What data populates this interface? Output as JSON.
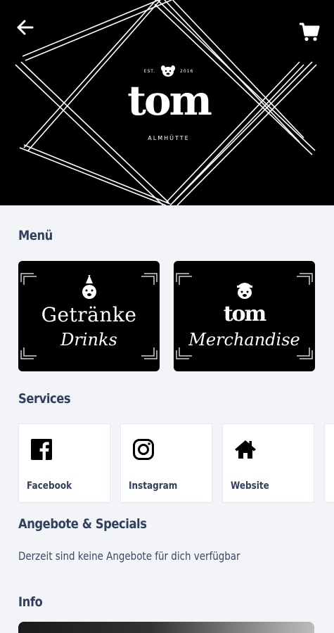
{
  "header": {
    "back_icon": "arrow-left-icon",
    "cart_icon": "cart-icon",
    "logo": {
      "est_left": "EST.",
      "est_right": "2016",
      "wordmark": "tom",
      "subtitle": "ALMHÜTTE"
    }
  },
  "menu": {
    "title": "Menü",
    "cards": [
      {
        "title": "Getränke",
        "subtitle": "Drinks",
        "icon": "dog-party-hat-icon"
      },
      {
        "title": "tom",
        "subtitle": "Merchandise",
        "icon": "dog-cap-icon"
      }
    ]
  },
  "services": {
    "title": "Services",
    "items": [
      {
        "label": "Facebook",
        "icon": "facebook-icon"
      },
      {
        "label": "Instagram",
        "icon": "instagram-icon"
      },
      {
        "label": "Website",
        "icon": "home-icon"
      }
    ]
  },
  "offers": {
    "title": "Angebote & Specials",
    "empty_message": "Derzeit sind keine Angebote für dich verfügbar"
  },
  "info": {
    "title": "Info"
  },
  "colors": {
    "background": "#f2f4f8",
    "heading": "#2f3f5d",
    "hero": "#000000",
    "card_bg": "#ffffff"
  }
}
